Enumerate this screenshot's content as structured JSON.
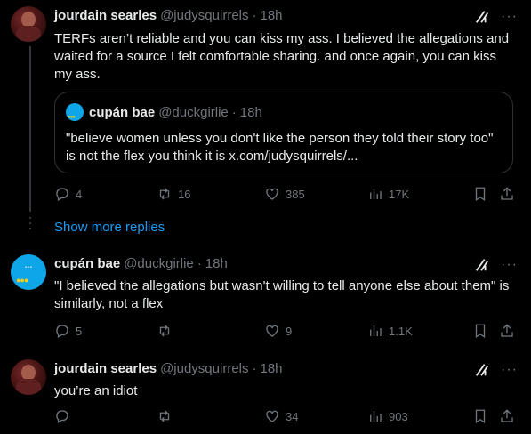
{
  "tweets": [
    {
      "name": "jourdain searles",
      "handle": "@judysquirrels",
      "time": "18h",
      "text": "TERFs aren’t reliable and you can kiss my ass. I believed the allegations and waited for a source I felt comfortable sharing. and once again, you can kiss my ass.",
      "quote": {
        "name": "cupán bae",
        "handle": "@duckgirlie",
        "time": "18h",
        "text": "\"believe women unless you don't like the person they told their story too\" is not the flex you think it is x.com/judysquirrels/..."
      },
      "replies": "4",
      "reposts": "16",
      "likes": "385",
      "views": "17K"
    },
    {
      "name": "cupán bae",
      "handle": "@duckgirlie",
      "time": "18h",
      "text": "\"I believed the allegations but wasn't willing to tell anyone else about them\" is similarly, not a flex",
      "replies": "5",
      "reposts": "",
      "likes": "9",
      "views": "1.1K"
    },
    {
      "name": "jourdain searles",
      "handle": "@judysquirrels",
      "time": "18h",
      "text": "you’re an idiot",
      "replies": "",
      "reposts": "",
      "likes": "34",
      "views": "903"
    }
  ],
  "show_more_label": "Show more replies",
  "separator": "·",
  "more_label": "···",
  "icons": {
    "reply": "reply-icon",
    "repost": "repost-icon",
    "like": "like-icon",
    "views": "views-icon",
    "bookmark": "bookmark-icon",
    "share": "share-icon",
    "grok": "grok-icon",
    "more": "more-icon"
  },
  "colors": {
    "background": "#000000",
    "text": "#e7e9ea",
    "muted": "#71767b",
    "link": "#1d9bf0",
    "border": "#2f3336"
  }
}
